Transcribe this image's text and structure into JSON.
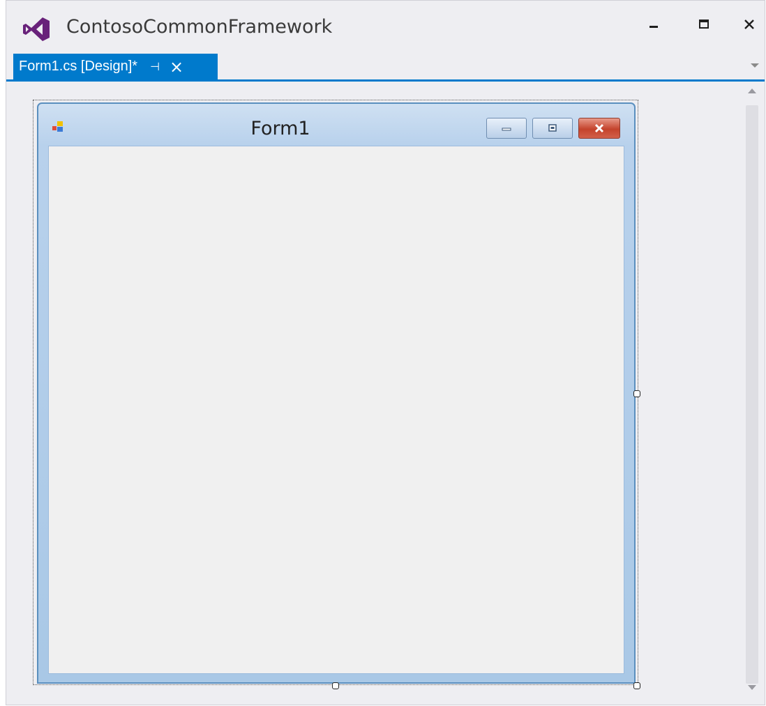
{
  "app": {
    "title": "ContosoCommonFramework",
    "logo": "visual-studio-logo",
    "accent_color": "#68217a"
  },
  "window_controls": {
    "minimize": "minimize-icon",
    "maximize": "maximize-icon",
    "close": "close-icon"
  },
  "tabs": [
    {
      "label": "Form1.cs [Design]*",
      "active": true,
      "pin_icon": "pin-icon",
      "close_icon": "close-icon"
    }
  ],
  "tab_accent_color": "#007acc",
  "designer": {
    "form": {
      "title": "Form1",
      "icon": "form-app-icon",
      "buttons": [
        "minimize-icon",
        "restore-icon",
        "close-icon"
      ],
      "close_color": "#c4432c"
    }
  }
}
